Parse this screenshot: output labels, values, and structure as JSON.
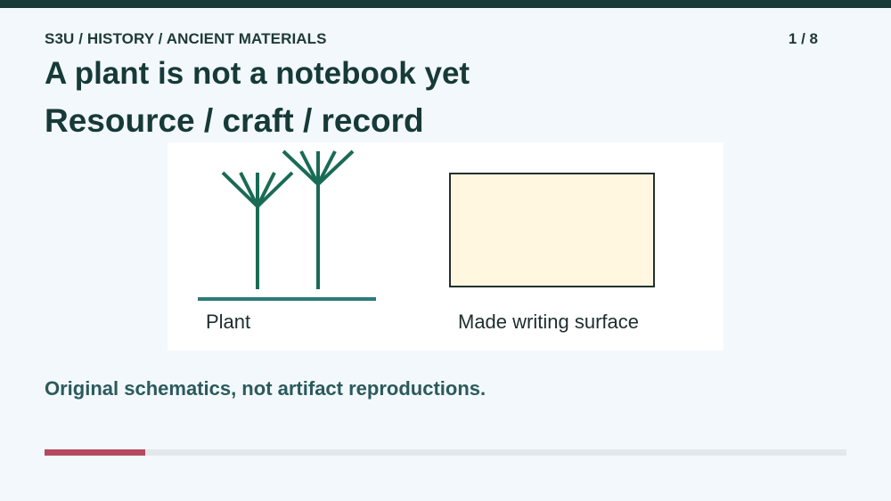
{
  "header": {
    "breadcrumb": "S3U / HISTORY / ANCIENT MATERIALS",
    "page_counter": "1 / 8"
  },
  "slide": {
    "title": "A plant is not a notebook yet",
    "subtitle": "Resource / craft / record",
    "caption": "Original schematics, not artifact reproductions."
  },
  "diagram": {
    "plant_label": "Plant",
    "surface_label": "Made writing surface",
    "colors": {
      "plant": "#1a6b55",
      "ground": "#2a7b78",
      "surface_fill": "#fff7e0",
      "surface_stroke": "#22302e"
    }
  },
  "progress": {
    "fraction": 0.125,
    "color": "#b5495f"
  }
}
